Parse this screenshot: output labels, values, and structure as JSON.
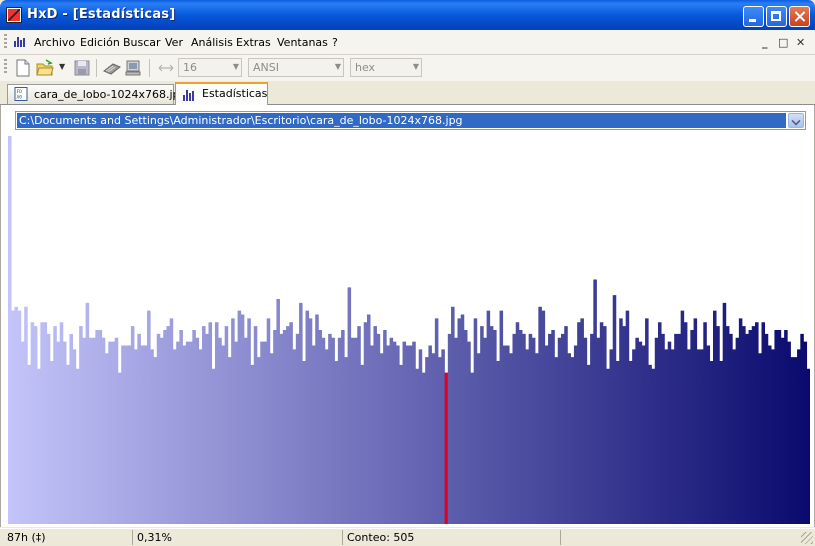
{
  "window": {
    "title": "HxD - [Estadísticas]"
  },
  "menu": {
    "items": [
      "Archivo",
      "Edición",
      "Buscar",
      "Ver",
      "Análisis",
      "Extras",
      "Ventanas",
      "?"
    ],
    "mdi_controls": [
      "_",
      "□",
      "✕"
    ]
  },
  "toolbar": {
    "bytes_per_row": "16",
    "charset": "ANSI",
    "offset_base": "hex"
  },
  "tabs": [
    {
      "label": "cara_de_lobo-1024x768.jpg",
      "active": false
    },
    {
      "label": "Estadísticas",
      "active": true
    }
  ],
  "stats": {
    "file_path": "C:\\Documents and Settings\\Administrador\\Escritorio\\cara_de_lobo-1024x768.jpg",
    "selected_byte": 135,
    "highlight_color": "#E0001C",
    "gradient_start": "#C4C4FA",
    "gradient_end": "#0A0A6E"
  },
  "chart_data": {
    "type": "bar",
    "x_range": [
      0,
      255
    ],
    "ylim": [
      0,
      1
    ],
    "values": [
      1.0,
      0.55,
      0.56,
      0.55,
      0.47,
      0.56,
      0.41,
      0.52,
      0.51,
      0.4,
      0.52,
      0.52,
      0.49,
      0.42,
      0.51,
      0.47,
      0.52,
      0.47,
      0.41,
      0.49,
      0.45,
      0.4,
      0.51,
      0.48,
      0.57,
      0.48,
      0.48,
      0.5,
      0.5,
      0.48,
      0.44,
      0.47,
      0.47,
      0.48,
      0.39,
      0.46,
      0.46,
      0.46,
      0.51,
      0.45,
      0.49,
      0.46,
      0.46,
      0.55,
      0.45,
      0.43,
      0.49,
      0.48,
      0.5,
      0.51,
      0.53,
      0.45,
      0.47,
      0.5,
      0.46,
      0.47,
      0.47,
      0.5,
      0.48,
      0.45,
      0.51,
      0.49,
      0.52,
      0.4,
      0.52,
      0.48,
      0.46,
      0.51,
      0.43,
      0.53,
      0.47,
      0.55,
      0.54,
      0.48,
      0.53,
      0.41,
      0.51,
      0.43,
      0.47,
      0.47,
      0.53,
      0.44,
      0.5,
      0.58,
      0.49,
      0.5,
      0.51,
      0.52,
      0.45,
      0.49,
      0.57,
      0.42,
      0.55,
      0.53,
      0.46,
      0.54,
      0.5,
      0.48,
      0.45,
      0.49,
      0.48,
      0.42,
      0.48,
      0.5,
      0.43,
      0.61,
      0.48,
      0.48,
      0.51,
      0.41,
      0.52,
      0.54,
      0.46,
      0.51,
      0.49,
      0.44,
      0.5,
      0.46,
      0.48,
      0.47,
      0.46,
      0.41,
      0.47,
      0.46,
      0.46,
      0.47,
      0.4,
      0.45,
      0.39,
      0.43,
      0.46,
      0.44,
      0.53,
      0.43,
      0.45,
      0.39,
      0.49,
      0.56,
      0.48,
      0.53,
      0.54,
      0.5,
      0.47,
      0.39,
      0.53,
      0.44,
      0.51,
      0.48,
      0.55,
      0.51,
      0.5,
      0.42,
      0.55,
      0.46,
      0.46,
      0.44,
      0.49,
      0.52,
      0.5,
      0.49,
      0.45,
      0.49,
      0.48,
      0.44,
      0.56,
      0.55,
      0.46,
      0.49,
      0.5,
      0.43,
      0.48,
      0.49,
      0.51,
      0.44,
      0.43,
      0.46,
      0.52,
      0.53,
      0.48,
      0.41,
      0.49,
      0.63,
      0.48,
      0.52,
      0.51,
      0.4,
      0.45,
      0.59,
      0.42,
      0.53,
      0.51,
      0.55,
      0.42,
      0.45,
      0.48,
      0.47,
      0.46,
      0.53,
      0.41,
      0.4,
      0.48,
      0.52,
      0.49,
      0.45,
      0.47,
      0.45,
      0.49,
      0.49,
      0.55,
      0.52,
      0.45,
      0.5,
      0.53,
      0.45,
      0.45,
      0.52,
      0.46,
      0.42,
      0.55,
      0.51,
      0.42,
      0.57,
      0.51,
      0.49,
      0.45,
      0.48,
      0.53,
      0.51,
      0.49,
      0.5,
      0.51,
      0.52,
      0.44,
      0.52,
      0.49,
      0.46,
      0.45,
      0.5,
      0.5,
      0.48,
      0.5,
      0.47,
      0.43,
      0.43,
      0.45,
      0.49,
      0.47,
      0.4
    ]
  },
  "status": {
    "byte": "87h (‡)",
    "percent": "0,31%",
    "count": "Conteo: 505"
  }
}
